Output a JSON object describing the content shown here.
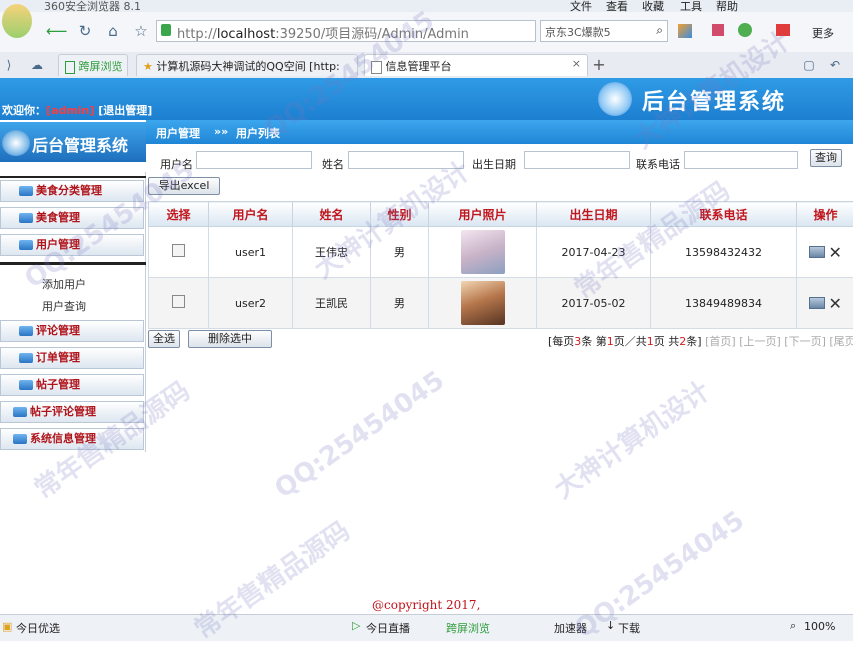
{
  "browser": {
    "app_title": "360安全浏览器 8.1",
    "menu": [
      "文件",
      "查看",
      "收藏",
      "工具",
      "帮助"
    ],
    "address_prefix": "http://",
    "address_host": "localhost",
    "address_rest": ":39250/项目源码/Admin/Admin",
    "search_text": "京东3C爆款5",
    "more_label": "更多",
    "tabs": [
      {
        "label": "跨屏浏览"
      },
      {
        "label": "计算机源码大神调试的QQ空间 [http:"
      },
      {
        "label": "信息管理平台"
      }
    ],
    "status": {
      "left": "今日优选",
      "live": "今日直播",
      "cross": "跨屏浏览",
      "accelerator": "加速器",
      "download": "下载",
      "zoom": "100%"
    }
  },
  "app": {
    "welcome_label": "欢迎你：",
    "user": "[admin]",
    "logout": "[退出管理]",
    "header_logo": "后台管理系统",
    "sidebar_logo": "后台管理系统",
    "breadcrumb": [
      "用户管理",
      "»»",
      "用户列表"
    ],
    "menu": [
      {
        "label": "美食分类管理"
      },
      {
        "label": "美食管理"
      },
      {
        "label": "用户管理"
      },
      {
        "label": "评论管理"
      },
      {
        "label": "订单管理"
      },
      {
        "label": "帖子管理"
      },
      {
        "label": "帖子评论管理"
      },
      {
        "label": "系统信息管理"
      }
    ],
    "submenu": [
      "添加用户",
      "用户查询"
    ],
    "search": {
      "username_label": "用户名",
      "name_label": "姓名",
      "birthday_label": "出生日期",
      "phone_label": "联系电话",
      "username_value": "",
      "name_value": "",
      "birthday_value": "",
      "phone_value": "",
      "query_button": "查询"
    },
    "export_button": "导出excel",
    "table": {
      "headers": [
        "选择",
        "用户名",
        "姓名",
        "性别",
        "用户照片",
        "出生日期",
        "联系电话",
        "操作"
      ],
      "rows": [
        {
          "username": "user1",
          "name": "王伟忠",
          "gender": "男",
          "birthday": "2017-04-23",
          "phone": "13598432432"
        },
        {
          "username": "user2",
          "name": "王凯民",
          "gender": "男",
          "birthday": "2017-05-02",
          "phone": "13849489834"
        }
      ]
    },
    "select_all": "全选",
    "delete_selected": "删除选中",
    "pager": {
      "per_page_prefix": "[每页",
      "per_page": "3",
      "per_page_suffix": "条",
      "page_prefix": "第",
      "page": "1",
      "page_mid": "页／共",
      "total_pages": "1",
      "page_suffix": "页",
      "total_prefix": "共",
      "total": "2",
      "total_suffix": "条]",
      "first": "[首页]",
      "prev": "[上一页]",
      "next": "[下一页]",
      "last": "[尾页]"
    },
    "copyright": "@copyright 2017,"
  },
  "watermarks": [
    "QQ:25454045",
    "大神计算机设计",
    "常年售精品源码",
    "QQ:25454045",
    "大神计算机设计",
    "常年售精品源码",
    "QQ:25454045",
    "大神计算机设计",
    "常年售精品源码",
    "QQ:25454045"
  ],
  "colors": {
    "accent": "#1e86d6",
    "menu_text": "#b0141b",
    "header_text": "#c2161d"
  }
}
